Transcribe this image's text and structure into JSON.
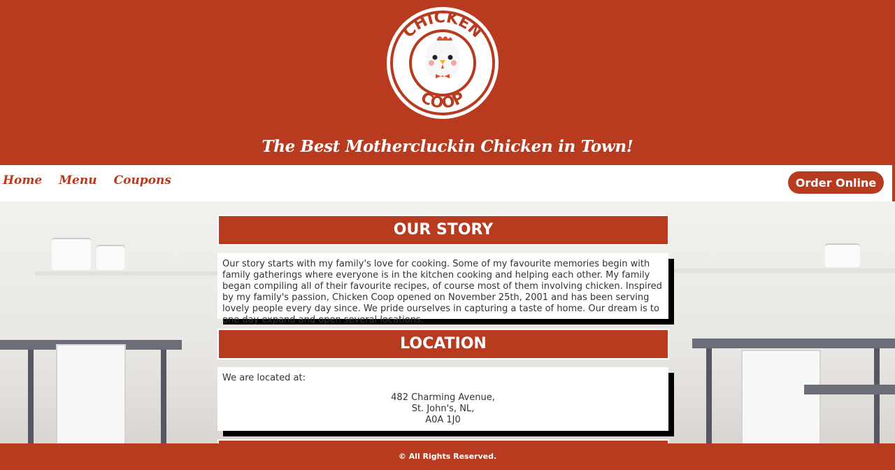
{
  "logo": {
    "top_text": "CHICKEN",
    "bottom_text": "COOP"
  },
  "tagline": "The Best Mothercluckin Chicken in Town!",
  "nav": {
    "home": "Home",
    "menu": "Menu",
    "coupons": "Coupons",
    "order_label": "Order Online"
  },
  "story": {
    "title": "OUR STORY",
    "text": "Our story starts with my family's love for cooking. Some of my favourite memories begin with family gatherings where everyone is in the kitchen cooking and helping each other. My family began compiling all of their favourite recipes, of course most of them involving chicken. Inspired by my family's passion, Chicken Coop opened on November 25th, 2001 and has been serving lovely people every day since. We pride ourselves in capturing a taste of home. Our dream is to one day expand and open several locations."
  },
  "location": {
    "title": "LOCATION",
    "intro": "We are located at:",
    "address_line1": "482 Charming Avenue,",
    "address_line2": "St. John's, NL,",
    "address_line3": "A0A 1J0"
  },
  "footer": "© All Rights Reserved.",
  "colors": {
    "brand": "#b83a1f",
    "white": "#ffffff"
  }
}
